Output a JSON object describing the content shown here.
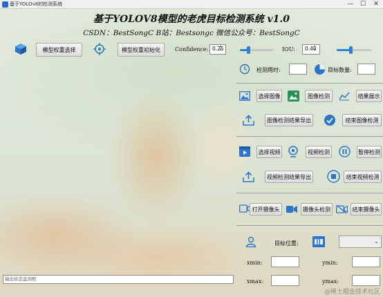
{
  "window": {
    "title": "基于YOLOv8的检测系统",
    "minimize": "—",
    "maximize": "☐",
    "close": "✕"
  },
  "header": {
    "title": "基于YOLOV8模型的老虎目标检测系统 v1.0",
    "subtitle": "CSDN：BestSongC   B站：Bestsongc   微信公众号：BestSongC"
  },
  "model": {
    "select_label": "模型权重选择",
    "init_label": "模型权重初始化",
    "confidence_label": "Confidence:",
    "confidence_value": "0.25",
    "confidence_level": 0.25,
    "iou_label": "IOU:",
    "iou_value": "0.40",
    "iou_level": 0.4
  },
  "stats": {
    "time_label": "检测用时:",
    "time_value": "",
    "count_label": "目标数量:",
    "count_value": ""
  },
  "image": {
    "select": "选择图像",
    "detect": "图像检测",
    "show": "结果展示",
    "export": "图像检测结果导出",
    "end": "结束图像检测"
  },
  "video": {
    "select": "选择视频",
    "detect": "视频检测",
    "pause": "暂停检测",
    "export": "视频检测结果导出",
    "end": "结束视频检测"
  },
  "camera": {
    "open": "打开摄像头",
    "detect": "摄像头检测",
    "end": "结束摄像头"
  },
  "target": {
    "position_label": "目标位置:",
    "combo_value": "",
    "xmin_label": "xmin:",
    "ymin_label": "ymin:",
    "xmax_label": "xmax:",
    "ymax_label": "ymax:",
    "xmin": "",
    "ymin": "",
    "xmax": "",
    "ymax": ""
  },
  "status": {
    "placeholder": "输出状态监测框"
  },
  "watermark": "@稀土掘金技术社区",
  "colors": {
    "accent": "#2f7ed8",
    "icon_blue": "#2c74c9"
  }
}
